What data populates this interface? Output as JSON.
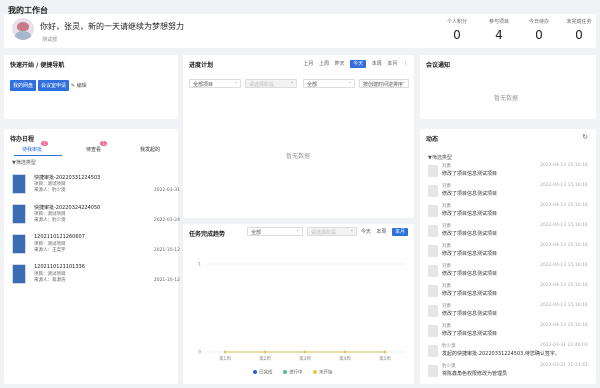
{
  "page_title": "我的工作台",
  "header": {
    "greeting": "你好，张灵，新的一天请继续为梦想努力",
    "dept": "测试部",
    "stats": [
      {
        "label": "个人积分",
        "value": "0"
      },
      {
        "label": "参与项目",
        "value": "4"
      },
      {
        "label": "今日待办",
        "value": "0"
      },
      {
        "label": "未完成任务",
        "value": "0"
      }
    ]
  },
  "quick_nav": {
    "title": "快速开始 / 便捷导航",
    "buttons": [
      "我的网盘",
      "会议室申请"
    ],
    "edit_label": "编辑"
  },
  "progress_plan": {
    "title": "进度计划",
    "periods": [
      "上月",
      "上周",
      "昨天",
      "今天",
      "本周",
      "本月"
    ],
    "active_period": "今天",
    "more_icon": "more-vertical-icon",
    "filters": [
      "全部项目",
      "请选择阶段",
      "全部",
      "按创建时间逆排序"
    ],
    "empty": "暂无数据"
  },
  "meeting": {
    "title": "会议通知",
    "empty": "暂无数据"
  },
  "todo": {
    "title": "待办日程",
    "tabs": [
      {
        "label": "待我审批",
        "badge": "1"
      },
      {
        "label": "待查看",
        "badge": "1"
      },
      {
        "label": "我发起的",
        "badge": ""
      }
    ],
    "filter_label": "筛选类型",
    "items": [
      {
        "title": "快捷审批-20220331224503",
        "project": "项目：测试项目",
        "from": "来源人：豹少澳",
        "date": "2022-03-31"
      },
      {
        "title": "快捷审批-20220324224050",
        "project": "项目：测试项目",
        "from": "来源人：豹少澳",
        "date": "2022-03-24"
      },
      {
        "title": "1202110121260607",
        "project": "项目：测试项目",
        "from": "来源人：王奕宇",
        "date": "2021-10-12"
      },
      {
        "title": "1202110121101336",
        "project": "项目：测试项目",
        "from": "来源人：蒋源浩",
        "date": "2021-10-12"
      }
    ]
  },
  "trend": {
    "title": "任务完成趋势",
    "filters": [
      "全部",
      "请选择阶段"
    ],
    "periods": [
      "今天",
      "本周",
      "本月"
    ],
    "active_period": "本月"
  },
  "chart_data": {
    "type": "line",
    "categories": [
      "第1周",
      "第2周",
      "第3周",
      "第4周",
      "第5周"
    ],
    "yticks": [
      "0",
      "1"
    ],
    "ylim": [
      0,
      1
    ],
    "series": [
      {
        "name": "已完成",
        "values": [
          0,
          0,
          0,
          0,
          0
        ],
        "color": "#3a5fcd"
      },
      {
        "name": "进行中",
        "values": [
          0,
          0,
          0,
          0,
          0
        ],
        "color": "#5cc08f"
      },
      {
        "name": "未开始",
        "values": [
          0,
          0,
          0,
          0,
          0
        ],
        "color": "#f5c242"
      }
    ]
  },
  "activity": {
    "title": "动态",
    "refresh_icon": "refresh-icon",
    "filter_label": "筛选类型",
    "items": [
      {
        "name": "刘勇",
        "text": "修改了项目信息测试项目",
        "time": "2022-04-13 15:16:16"
      },
      {
        "name": "刘勇",
        "text": "修改了项目信息测试项目",
        "time": "2022-04-13 15:16:16"
      },
      {
        "name": "刘勇",
        "text": "修改了项目信息测试项目",
        "time": "2022-04-13 15:16:16"
      },
      {
        "name": "刘勇",
        "text": "修改了项目信息测试项目",
        "time": "2022-04-13 15:16:16"
      },
      {
        "name": "刘勇",
        "text": "修改了项目信息测试项目",
        "time": "2022-04-13 15:16:16"
      },
      {
        "name": "刘勇",
        "text": "修改了项目信息测试项目",
        "time": "2022-04-13 15:16:16"
      },
      {
        "name": "刘勇",
        "text": "修改了项目信息测试项目",
        "time": "2022-04-13 15:16:16"
      },
      {
        "name": "刘勇",
        "text": "修改了项目信息测试项目",
        "time": "2022-04-13 15:16:16"
      },
      {
        "name": "刘勇",
        "text": "修改了项目信息测试项目",
        "time": "2022-04-13 15:16:16"
      },
      {
        "name": "豹少澳",
        "text": "发起的快捷审批-20220331224503,待您确认签字。",
        "time": "2022-03-31 22:46:03"
      },
      {
        "name": "豹少澳",
        "text": "将陈鑫角色权限修改为管理员",
        "time": "2022-03-21 11:21:41"
      }
    ]
  }
}
